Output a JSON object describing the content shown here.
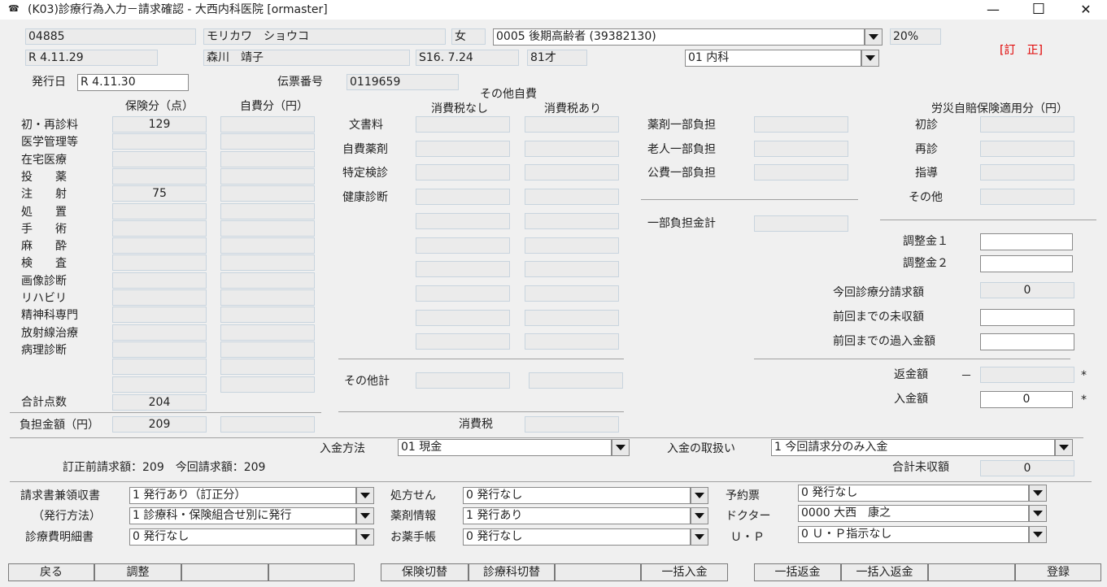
{
  "window": {
    "title": "(K03)診療行為入力－請求確認 - 大西内科医院  [ormaster]",
    "minimize": "—",
    "maximize": "☐",
    "close": "✕"
  },
  "patient": {
    "id": "04885",
    "kana": "モリカワ　ショウコ",
    "sex": "女",
    "insurance": "0005 後期高齢者 (39382130)",
    "rate": "20%",
    "date": "R 4.11.29",
    "name": "森川　靖子",
    "birth": "S16. 7.24",
    "age": "81才",
    "department": "01 内科",
    "correction": "[訂　正]"
  },
  "issue": {
    "label": "発行日",
    "date": "R 4.11.30",
    "slip_label": "伝票番号",
    "slip_no": "0119659"
  },
  "left": {
    "header_ins": "保険分（点）",
    "header_self": "自費分（円）",
    "rows": [
      {
        "label": "初・再診料",
        "ins": "129"
      },
      {
        "label": "医学管理等",
        "ins": ""
      },
      {
        "label": "在宅医療",
        "ins": ""
      },
      {
        "label": "投　　薬",
        "ins": ""
      },
      {
        "label": "注　　射",
        "ins": "75"
      },
      {
        "label": "処　　置",
        "ins": ""
      },
      {
        "label": "手　　術",
        "ins": ""
      },
      {
        "label": "麻　　酔",
        "ins": ""
      },
      {
        "label": "検　　査",
        "ins": ""
      },
      {
        "label": "画像診断",
        "ins": ""
      },
      {
        "label": "リハビリ",
        "ins": ""
      },
      {
        "label": "精神科専門",
        "ins": ""
      },
      {
        "label": "放射線治療",
        "ins": ""
      },
      {
        "label": "病理診断",
        "ins": ""
      },
      {
        "label": "",
        "ins": ""
      },
      {
        "label": "",
        "ins": ""
      }
    ],
    "total_label": "合計点数",
    "total": "204",
    "burden_label": "負担金額（円）",
    "burden": "209"
  },
  "middle": {
    "title": "その他自費",
    "no_tax": "消費税なし",
    "with_tax": "消費税あり",
    "rows": [
      "文書料",
      "自費薬剤",
      "特定検診",
      "健康診断",
      "",
      "",
      "",
      "",
      "",
      ""
    ],
    "subtotal_label": "その他計",
    "tax_label": "消費税"
  },
  "partial": {
    "rows": [
      "薬剤一部負担",
      "老人一部負担",
      "公費一部負担"
    ],
    "total_label": "一部負担金計"
  },
  "rousai": {
    "title": "労災自賠保険適用分（円）",
    "rows": [
      "初診",
      "再診",
      "指導",
      "その他"
    ]
  },
  "adjust": {
    "adj1": "調整金１",
    "adj2": "調整金２",
    "current_label": "今回診療分請求額",
    "current": "0",
    "unpaid_label": "前回までの未収額",
    "over_label": "前回までの過入金額",
    "refund_label": "返金額",
    "refund_dash": "－",
    "paid_label": "入金額",
    "paid": "0",
    "star": "*"
  },
  "payment": {
    "method_label": "入金方法",
    "method": "01 現金",
    "handling_label": "入金の取扱い",
    "handling": "1 今回請求分のみ入金",
    "summary": "訂正前請求額：209　今回請求額：209",
    "uncollected_label": "合計未収額",
    "uncollected": "0"
  },
  "print": {
    "receipt_label": "請求書兼領収書",
    "receipt": "1 発行あり（訂正分）",
    "method_label": "（発行方法）",
    "method": "1 診療科・保険組合せ別に発行",
    "detail_label": "診療費明細書",
    "detail": "0 発行なし",
    "rx_label": "処方せん",
    "rx": "0 発行なし",
    "drug_label": "薬剤情報",
    "drug": "1 発行あり",
    "notebook_label": "お薬手帳",
    "notebook": "0 発行なし",
    "appt_label": "予約票",
    "appt": "0 発行なし",
    "doctor_label": "ドクター",
    "doctor": "0000 大西　康之",
    "up_label": "Ｕ・Ｐ",
    "up": "0 Ｕ・Ｐ指示なし"
  },
  "buttons": [
    "戻る",
    "調整",
    "",
    "",
    "保険切替",
    "診療科切替",
    "",
    "一括入金",
    "一括返金",
    "一括入返金",
    "",
    "登録"
  ]
}
